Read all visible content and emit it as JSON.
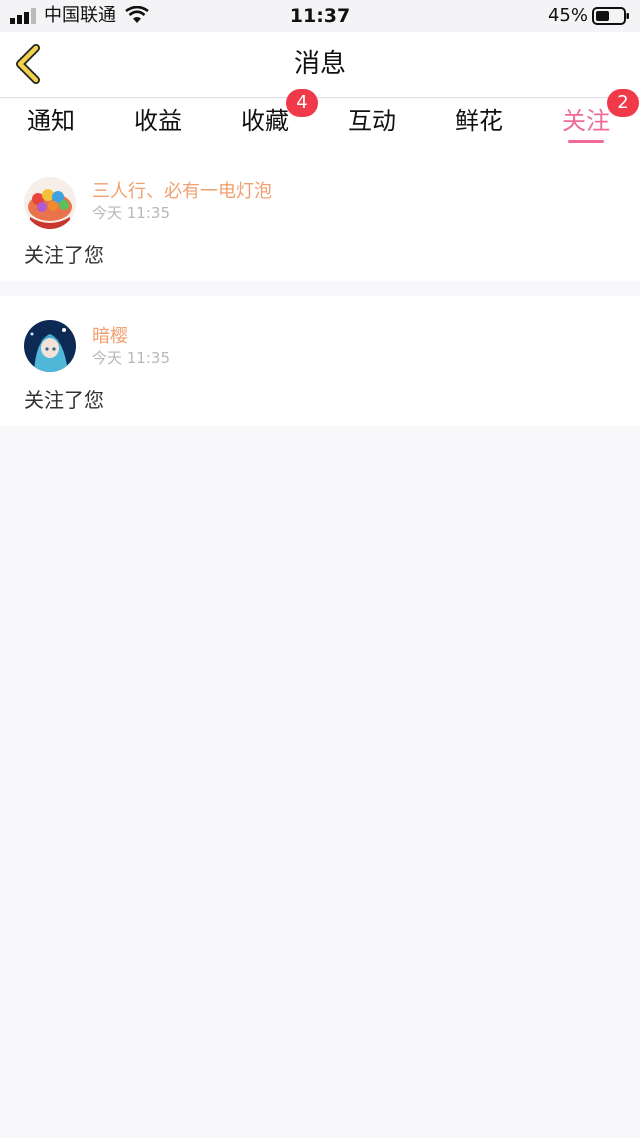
{
  "status_bar": {
    "carrier": "中国联通",
    "time": "11:37",
    "battery": "45%",
    "icons": [
      "signal-icon",
      "wifi-icon",
      "battery-icon"
    ]
  },
  "header": {
    "title": "消息",
    "back_icon": "chevron-left-icon",
    "accent_color": "#f2d24a"
  },
  "tabs": [
    {
      "label": "通知",
      "badge": null,
      "active": false
    },
    {
      "label": "收益",
      "badge": null,
      "active": false
    },
    {
      "label": "收藏",
      "badge": "4",
      "active": false
    },
    {
      "label": "互动",
      "badge": null,
      "active": false
    },
    {
      "label": "鲜花",
      "badge": null,
      "active": false
    },
    {
      "label": "关注",
      "badge": "2",
      "active": true
    }
  ],
  "colors": {
    "active_tab": "#ef6a9a",
    "badge": "#f03a4a",
    "username": "#f0a070",
    "timestamp": "#b8b8bc"
  },
  "messages": [
    {
      "username": "三人行、必有一电灯泡",
      "time": "今天 11:35",
      "text": "关注了您"
    },
    {
      "username": "暗樱",
      "time": "今天 11:35",
      "text": "关注了您"
    }
  ]
}
